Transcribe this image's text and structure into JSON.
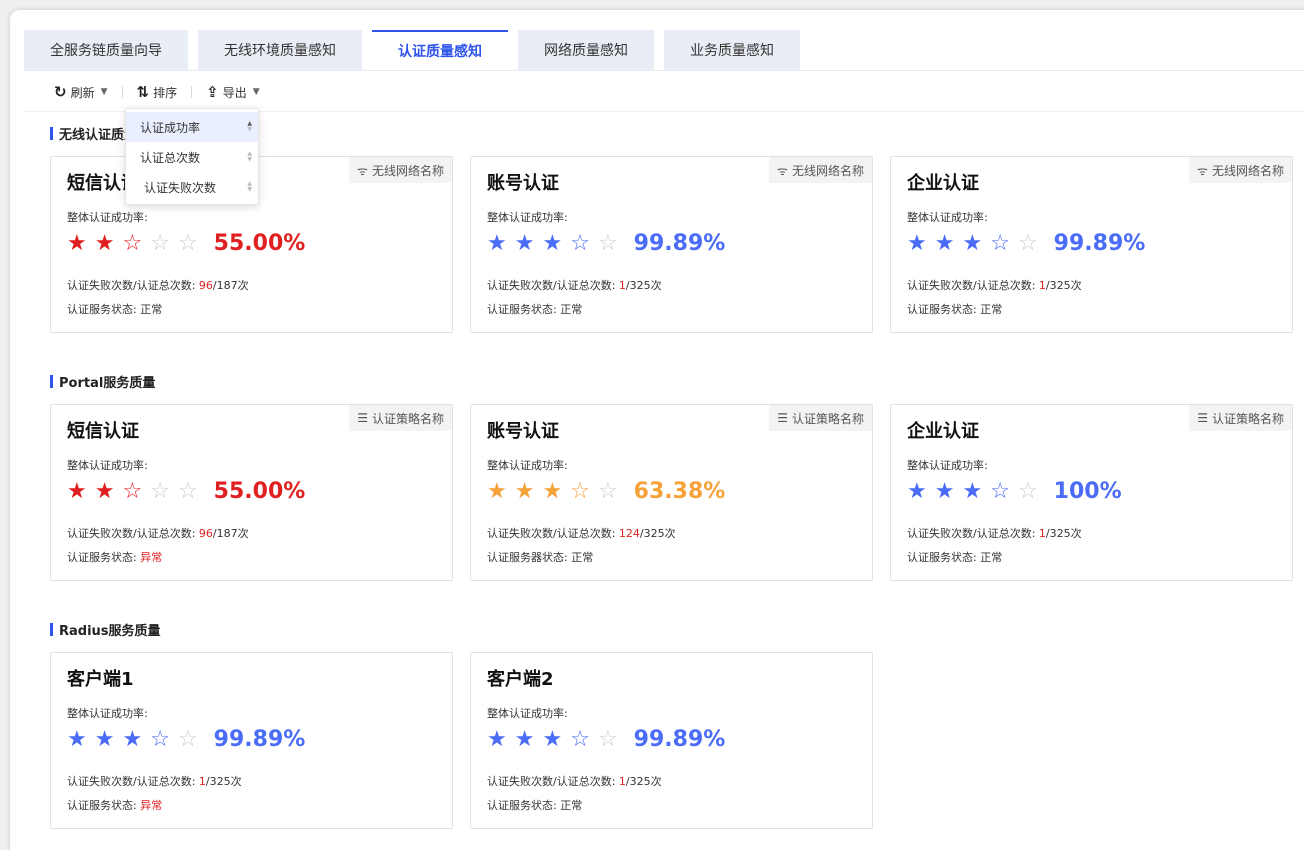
{
  "colors": {
    "accent": "#2f54eb",
    "red": "#e02020",
    "orange": "#f6a23a",
    "blue_star": "#4a6cf7",
    "empty_star": "#c9ccd3"
  },
  "tabs": [
    {
      "label": "全服务链质量向导"
    },
    {
      "label": "无线环境质量感知"
    },
    {
      "label": "认证质量感知",
      "active": true
    },
    {
      "label": "网络质量感知"
    },
    {
      "label": "业务质量感知"
    }
  ],
  "toolbar": {
    "refresh_label": "刷新",
    "sort_label": "排序",
    "export_label": "导出"
  },
  "sort_dropdown": {
    "options": [
      {
        "label": "认证成功率",
        "selected": true
      },
      {
        "label": "认证总次数"
      },
      {
        "label": "认证失败次数"
      }
    ]
  },
  "sections": [
    {
      "title": "无线认证质量",
      "tag_icon": "wifi-icon",
      "cards": [
        {
          "name": "短信认证",
          "tag": "无线网络名称",
          "sub": "整体认证成功率:",
          "stars": 2,
          "pct": "55.00%",
          "color": "red",
          "fail_label": "认证失败次数/认证总次数:",
          "fail": "96",
          "total": "/187次",
          "status_label": "认证服务状态:",
          "status": "正常",
          "status_alert": false
        },
        {
          "name": "账号认证",
          "tag": "无线网络名称",
          "sub": "整体认证成功率:",
          "stars": 3,
          "pct": "99.89%",
          "color": "blue",
          "fail_label": "认证失败次数/认证总次数:",
          "fail": "1",
          "total": "/325次",
          "status_label": "认证服务状态:",
          "status": "正常",
          "status_alert": false
        },
        {
          "name": "企业认证",
          "tag": "无线网络名称",
          "sub": "整体认证成功率:",
          "stars": 3,
          "pct": "99.89%",
          "color": "blue",
          "fail_label": "认证失败次数/认证总次数:",
          "fail": "1",
          "total": "/325次",
          "status_label": "认证服务状态:",
          "status": "正常",
          "status_alert": false
        }
      ]
    },
    {
      "title": "Portal服务质量",
      "tag_icon": "list-icon",
      "cards": [
        {
          "name": "短信认证",
          "tag": "认证策略名称",
          "sub": "整体认证成功率:",
          "stars": 2,
          "pct": "55.00%",
          "color": "red",
          "fail_label": "认证失败次数/认证总次数:",
          "fail": "96",
          "total": "/187次",
          "status_label": "认证服务状态:",
          "status": "异常",
          "status_alert": true
        },
        {
          "name": "账号认证",
          "tag": "认证策略名称",
          "sub": "整体认证成功率:",
          "stars": 3,
          "pct": "63.38%",
          "color": "orange",
          "fail_label": "认证失败次数/认证总次数:",
          "fail": "124",
          "total": "/325次",
          "status_label": "认证服务器状态:",
          "status": "正常",
          "status_alert": false
        },
        {
          "name": "企业认证",
          "tag": "认证策略名称",
          "sub": "整体认证成功率:",
          "stars": 3,
          "pct": "100%",
          "color": "blue",
          "fail_label": "认证失败次数/认证总次数:",
          "fail": "1",
          "total": "/325次",
          "status_label": "认证服务状态:",
          "status": "正常",
          "status_alert": false
        }
      ]
    },
    {
      "title": "Radius服务质量",
      "tag_icon": "",
      "cards": [
        {
          "name": "客户端1",
          "tag": "",
          "sub": "整体认证成功率:",
          "stars": 3,
          "pct": "99.89%",
          "color": "blue",
          "fail_label": "认证失败次数/认证总次数:",
          "fail": "1",
          "total": "/325次",
          "status_label": "认证服务状态:",
          "status": "异常",
          "status_alert": true
        },
        {
          "name": "客户端2",
          "tag": "",
          "sub": "整体认证成功率:",
          "stars": 3,
          "pct": "99.89%",
          "color": "blue",
          "fail_label": "认证失败次数/认证总次数:",
          "fail": "1",
          "total": "/325次",
          "status_label": "认证服务状态:",
          "status": "正常",
          "status_alert": false
        }
      ]
    }
  ]
}
